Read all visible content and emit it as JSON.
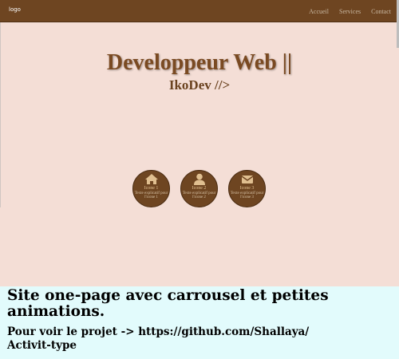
{
  "navbar": {
    "logo": "logo",
    "links": [
      "Accueil",
      "Services",
      "Contact"
    ]
  },
  "hero": {
    "title": "Developpeur Web ||",
    "subtitle": "IkoDev //>"
  },
  "features": [
    {
      "icon": "home-icon",
      "title": "Icone 1",
      "text": "Texte explicatif pour",
      "text2": "l'icone 1"
    },
    {
      "icon": "user-icon",
      "title": "Icone 2",
      "text": "Texte explicatif pour",
      "text2": "l'icone 2"
    },
    {
      "icon": "mail-icon",
      "title": "Icone 3",
      "text": "Texte explicatif pour",
      "text2": "l'icone 3"
    }
  ],
  "caption": {
    "title": "Site one-page avec carrousel et petites animations.",
    "text": "Pour voir le projet -> https://github.com/Shallaya/\nActivit-type"
  },
  "colors": {
    "navbar": "#6e4521",
    "background": "#f4ded6",
    "accent_brown": "#7a4a22",
    "icon_gold": "#e0bf90",
    "caption_bg": "#e2fbfc"
  }
}
